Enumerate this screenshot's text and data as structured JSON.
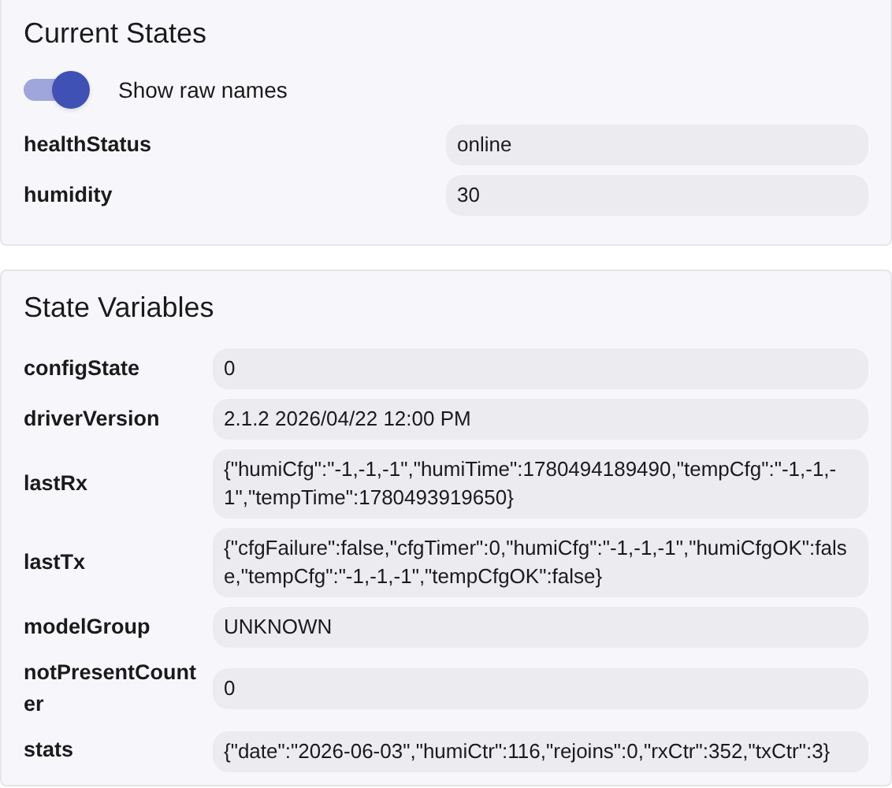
{
  "current_states": {
    "title": "Current States",
    "toggle": {
      "label": "Show raw names",
      "on": true
    },
    "rows": [
      {
        "name": "healthStatus",
        "value": "online"
      },
      {
        "name": "humidity",
        "value": "30"
      }
    ]
  },
  "state_variables": {
    "title": "State Variables",
    "rows": [
      {
        "name": "configState",
        "value": "0"
      },
      {
        "name": "driverVersion",
        "value": "2.1.2 2026/04/22 12:00 PM"
      },
      {
        "name": "lastRx",
        "value": "{\"humiCfg\":\"-1,-1,-1\",\"humiTime\":1780494189490,\"tempCfg\":\"-1,-1,-1\",\"tempTime\":1780493919650}"
      },
      {
        "name": "lastTx",
        "value": "{\"cfgFailure\":false,\"cfgTimer\":0,\"humiCfg\":\"-1,-1,-1\",\"humiCfgOK\":false,\"tempCfg\":\"-1,-1,-1\",\"tempCfgOK\":false}"
      },
      {
        "name": "modelGroup",
        "value": "UNKNOWN"
      },
      {
        "name": "notPresentCounter",
        "value": "0"
      },
      {
        "name": "stats",
        "value": "{\"date\":\"2026-06-03\",\"humiCtr\":116,\"rejoins\":0,\"rxCtr\":352,\"txCtr\":3}"
      }
    ]
  }
}
